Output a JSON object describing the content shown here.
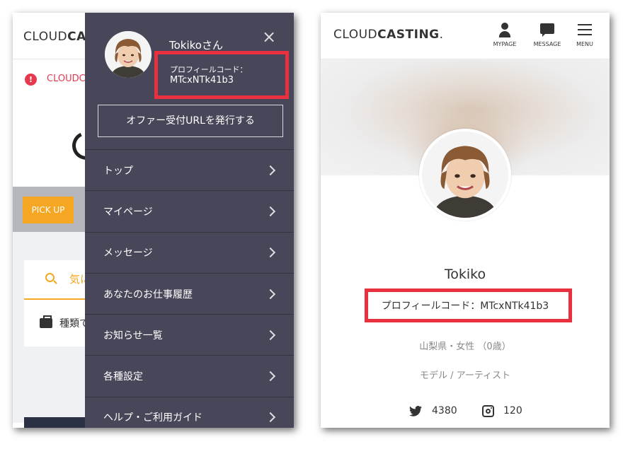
{
  "left_screen": {
    "background": {
      "logo_light": "CLOUD",
      "logo_bold": "CA",
      "alert_icon_glyph": "!",
      "alert_text": "CLOUDC",
      "pickup_label": "PICK UP",
      "search_text": "気に",
      "category_text": "種類で"
    },
    "drawer": {
      "username": "Tokikoさん",
      "close_glyph": "×",
      "profile_code_label": "プロフィールコード：",
      "profile_code_value": "MTcxNTk41b3",
      "offer_button_label": "オファー受付URLを発行する",
      "menu_items": [
        {
          "label": "トップ"
        },
        {
          "label": "マイページ"
        },
        {
          "label": "メッセージ"
        },
        {
          "label": "あなたのお仕事履歴"
        },
        {
          "label": "お知らせ一覧"
        },
        {
          "label": "各種設定"
        },
        {
          "label": "ヘルプ・ご利用ガイド"
        }
      ]
    }
  },
  "right_screen": {
    "header": {
      "logo_light": "CLOUD",
      "logo_bold": "CASTING",
      "logo_dot": ".",
      "nav": {
        "mypage_label": "MYPAGE",
        "message_label": "MESSAGE",
        "menu_label": "MENU"
      }
    },
    "profile": {
      "name": "Tokiko",
      "profile_code": "プロフィールコード：MTcxNTk41b3",
      "location": "山梨県・女性 （0歳）",
      "category": "モデル / アーティスト",
      "twitter_count": "4380",
      "instagram_count": "120"
    }
  },
  "colors": {
    "highlight_red": "#e8303f",
    "drawer_bg": "#484659",
    "accent_orange": "#f5a623",
    "alert_red": "#e53950"
  },
  "icons": [
    "alert-icon",
    "close-icon",
    "chevron-right-icon",
    "search-icon",
    "briefcase-icon",
    "person-icon",
    "message-icon",
    "menu-icon",
    "twitter-icon",
    "instagram-icon"
  ]
}
